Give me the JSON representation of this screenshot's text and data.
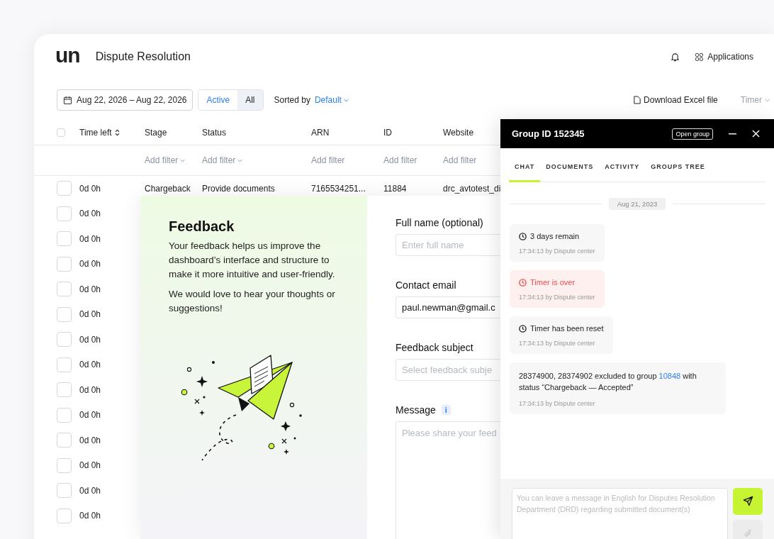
{
  "app": {
    "logo": "un",
    "title": "Dispute Resolution",
    "applications": "Applications"
  },
  "toolbar": {
    "date_range": "Aug 22, 2026 – Aug 22, 2026",
    "segments": [
      {
        "label": "Active",
        "selected": true
      },
      {
        "label": "All",
        "selected": false
      }
    ],
    "sort_label": "Sorted by",
    "sort_value": "Default",
    "download": "Download Excel file",
    "timer": "Timer"
  },
  "table": {
    "select_all_checked": false,
    "columns": [
      {
        "label": "Time left",
        "sortable": true
      },
      {
        "label": "Stage",
        "sortable": false,
        "filter": {
          "text": "Add filter",
          "dropdown": true
        }
      },
      {
        "label": "Status",
        "sortable": false,
        "filter": {
          "text": "Add filter",
          "dropdown": true
        }
      },
      {
        "label": "ARN",
        "sortable": false,
        "filter": {
          "text": "Add filter",
          "dropdown": false
        }
      },
      {
        "label": "ID",
        "sortable": false,
        "filter": {
          "text": "Add filter",
          "dropdown": false
        }
      },
      {
        "label": "Website",
        "sortable": false,
        "filter": {
          "text": "Add filter",
          "dropdown": false
        }
      }
    ],
    "rows": [
      {
        "checked": false,
        "cells": [
          "0d 0h",
          "Chargeback",
          "Provide documents",
          "7165534251...",
          "11884",
          "drc_avtotest_di"
        ]
      },
      {
        "checked": false,
        "cells": [
          "0d 0h"
        ]
      },
      {
        "checked": false,
        "cells": [
          "0d 0h"
        ]
      },
      {
        "checked": false,
        "cells": [
          "0d 0h"
        ]
      },
      {
        "checked": false,
        "cells": [
          "0d 0h"
        ]
      },
      {
        "checked": false,
        "cells": [
          "0d 0h"
        ]
      },
      {
        "checked": false,
        "cells": [
          "0d 0h"
        ]
      },
      {
        "checked": false,
        "cells": [
          "0d 0h"
        ]
      },
      {
        "checked": false,
        "cells": [
          "0d 0h"
        ]
      },
      {
        "checked": false,
        "cells": [
          "0d 0h"
        ]
      },
      {
        "checked": false,
        "cells": [
          "0d 0h"
        ]
      },
      {
        "checked": false,
        "cells": [
          "0d 0h"
        ]
      },
      {
        "checked": false,
        "cells": [
          "0d 0h"
        ]
      },
      {
        "checked": false,
        "cells": [
          "0d 0h"
        ]
      }
    ]
  },
  "feedback": {
    "title": "Feedback",
    "paragraphs": [
      "Your feedback helps us improve the dashboard’s interface and structure to make it more intuitive and user-friendly.",
      "We would love to hear your thoughts or suggestions!"
    ],
    "fields": [
      {
        "kind": "input",
        "label": "Full name (optional)",
        "placeholder": "Enter full name"
      },
      {
        "kind": "input",
        "label": "Contact email",
        "value": "paul.newman@gmail.c"
      },
      {
        "kind": "select",
        "label": "Feedback subject",
        "placeholder": "Select feedback subje"
      },
      {
        "kind": "textarea",
        "label": "Message",
        "info": "i",
        "placeholder": "Please share your feed"
      }
    ]
  },
  "chat": {
    "title": "Group ID 152345",
    "open_group": "Open group",
    "tabs": [
      {
        "label": "CHAT",
        "selected": true
      },
      {
        "label": "DOCUMENTS",
        "selected": false
      },
      {
        "label": "ACTIVITY",
        "selected": false
      },
      {
        "label": "GROUPS TREE",
        "selected": false
      }
    ],
    "date": "Aug 21, 2023",
    "messages": [
      {
        "kind": "timer",
        "text": "3 days remain",
        "meta": "17:34:13 by Dispute center"
      },
      {
        "kind": "alert",
        "text": "Timer is over",
        "meta": "17:34:13 by Dispute center"
      },
      {
        "kind": "timer",
        "text": "Timer has been reset",
        "meta": "17:34:13 by Dispute center"
      },
      {
        "kind": "note",
        "text": "28374900, 28374902 excluded to group",
        "link": "10848",
        "text_after": "with status “Chargeback — Accepted”",
        "meta": "17:34:13 by Dispute center"
      }
    ],
    "composer_placeholder": "You can leave a message in English for Disputes Resolution Department (DRD) regarding submitted document(s)"
  }
}
